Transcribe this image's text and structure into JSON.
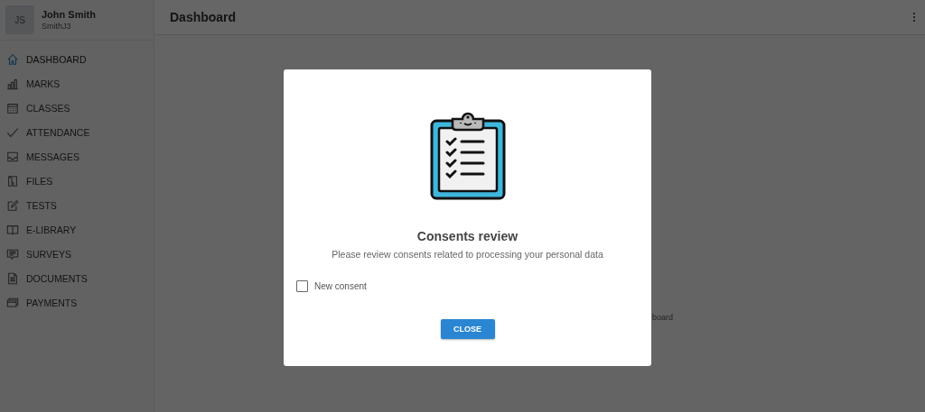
{
  "user": {
    "initials": "JS",
    "name": "John Smith",
    "username": "SmithJ3"
  },
  "sidebar": {
    "items": [
      {
        "label": "DASHBOARD",
        "selected": true
      },
      {
        "label": "MARKS",
        "selected": false
      },
      {
        "label": "CLASSES",
        "selected": false
      },
      {
        "label": "ATTENDANCE",
        "selected": false
      },
      {
        "label": "MESSAGES",
        "selected": false
      },
      {
        "label": "FILES",
        "selected": false
      },
      {
        "label": "TESTS",
        "selected": false
      },
      {
        "label": "E-LIBRARY",
        "selected": false
      },
      {
        "label": "SURVEYS",
        "selected": false
      },
      {
        "label": "DOCUMENTS",
        "selected": false
      },
      {
        "label": "PAYMENTS",
        "selected": false
      }
    ]
  },
  "header": {
    "title": "Dashboard"
  },
  "main": {
    "partial_text": "board"
  },
  "dialog": {
    "title": "Consents review",
    "subtitle": "Please review consents related to processing your personal data",
    "consents": [
      {
        "label": "New consent",
        "checked": false
      }
    ],
    "button": "CLOSE"
  }
}
